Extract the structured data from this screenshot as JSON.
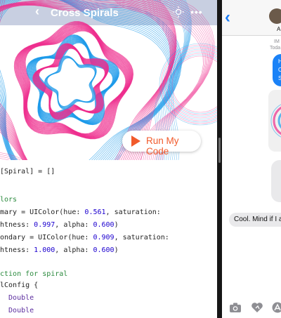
{
  "playground": {
    "title": "Cross Spirals",
    "run_button_label": "Run My Code",
    "code_lines": [
      {
        "parts": [
          {
            "t": "[Spiral] = []",
            "c": ""
          }
        ]
      },
      {
        "parts": [
          {
            "t": "",
            "c": ""
          }
        ]
      },
      {
        "parts": [
          {
            "t": "lors",
            "c": "cm"
          }
        ]
      },
      {
        "parts": [
          {
            "t": "mary = UIColor(hue: ",
            "c": ""
          },
          {
            "t": "0.561",
            "c": "num"
          },
          {
            "t": ", saturation:",
            "c": ""
          }
        ]
      },
      {
        "parts": [
          {
            "t": "htness: ",
            "c": ""
          },
          {
            "t": "0.997",
            "c": "num"
          },
          {
            "t": ", alpha: ",
            "c": ""
          },
          {
            "t": "0.600",
            "c": "num"
          },
          {
            "t": ")",
            "c": ""
          }
        ]
      },
      {
        "parts": [
          {
            "t": "ondary = UIColor(hue: ",
            "c": ""
          },
          {
            "t": "0.909",
            "c": "num"
          },
          {
            "t": ", saturation:",
            "c": ""
          }
        ]
      },
      {
        "parts": [
          {
            "t": "htness: ",
            "c": ""
          },
          {
            "t": "1.000",
            "c": "num"
          },
          {
            "t": ", alpha: ",
            "c": ""
          },
          {
            "t": "0.600",
            "c": "num"
          },
          {
            "t": ")",
            "c": ""
          }
        ]
      },
      {
        "parts": [
          {
            "t": "",
            "c": ""
          }
        ]
      },
      {
        "parts": [
          {
            "t": "ction for spiral",
            "c": "cm"
          }
        ]
      },
      {
        "parts": [
          {
            "t": "lConfig {",
            "c": ""
          }
        ]
      },
      {
        "parts": [
          {
            "t": "  Double",
            "c": "ty"
          }
        ]
      },
      {
        "parts": [
          {
            "t": "  Double",
            "c": "ty"
          }
        ]
      }
    ],
    "colors": {
      "primary": "#1e9bea",
      "secondary": "#ee2b8c",
      "accent": "#f15a2b"
    }
  },
  "messages": {
    "contact_name_fragment": "A",
    "timestamp_line1": "IM",
    "timestamp_line2": "Toda",
    "outgoing_text_lines": [
      "H",
      "C",
      "S"
    ],
    "reply_text": "Cool. Mind if I a"
  }
}
